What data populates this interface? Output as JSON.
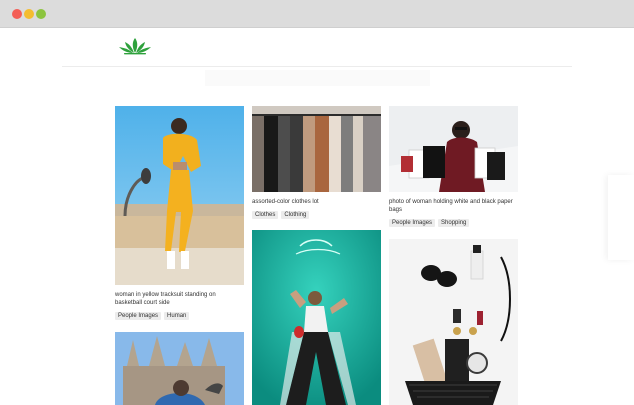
{
  "window": {
    "controls": [
      "close",
      "minimize",
      "zoom"
    ]
  },
  "header": {
    "logo": "lotus-logo"
  },
  "columns": [
    {
      "items": [
        {
          "caption": "woman in yellow tracksuit standing on basketball court side",
          "tags": [
            "People Images",
            "Human"
          ]
        },
        {
          "caption": "",
          "tags": []
        }
      ]
    },
    {
      "items": [
        {
          "caption": "assorted-color clothes lot",
          "tags": [
            "Clothes",
            "Clothing"
          ]
        },
        {
          "caption": "",
          "tags": []
        }
      ]
    },
    {
      "items": [
        {
          "caption": "photo of woman holding white and black paper bags",
          "tags": [
            "People Images",
            "Shopping"
          ]
        },
        {
          "caption": "",
          "tags": []
        }
      ]
    }
  ],
  "colors": {
    "titlebar": "#dcdcdc",
    "logo_green": "#2ea13c",
    "tag_bg": "#ececec"
  }
}
